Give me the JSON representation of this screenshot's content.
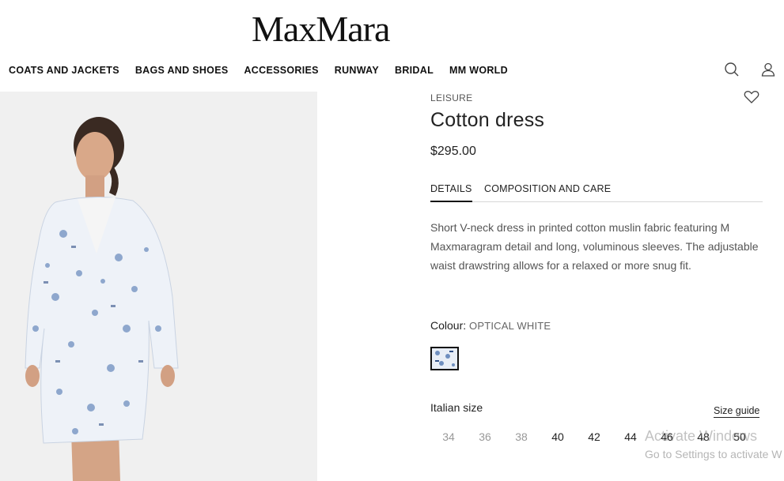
{
  "brand": {
    "logo_text": "MaxMara"
  },
  "nav": {
    "items": [
      {
        "label": "COATS AND JACKETS"
      },
      {
        "label": "BAGS AND SHOES"
      },
      {
        "label": "ACCESSORIES"
      },
      {
        "label": "RUNWAY"
      },
      {
        "label": "BRIDAL"
      },
      {
        "label": "MM WORLD"
      }
    ],
    "icons": {
      "search": "search-icon",
      "account": "user-icon"
    }
  },
  "product": {
    "category": "LEISURE",
    "title": "Cotton dress",
    "price": "$295.00",
    "tabs": [
      {
        "label": "DETAILS",
        "active": true
      },
      {
        "label": "COMPOSITION AND CARE",
        "active": false
      }
    ],
    "description": "Short V-neck dress in printed cotton muslin fabric featuring M Maxmaragram detail and long, voluminous sleeves. The adjustable waist drawstring allows for a relaxed or more snug fit.",
    "colour_label": "Colour:",
    "colour_value": "OPTICAL WHITE",
    "size_label": "Italian size",
    "size_guide": "Size guide",
    "sizes": [
      {
        "label": "34",
        "available": false
      },
      {
        "label": "36",
        "available": false
      },
      {
        "label": "38",
        "available": false
      },
      {
        "label": "40",
        "available": true
      },
      {
        "label": "42",
        "available": true
      },
      {
        "label": "44",
        "available": true
      },
      {
        "label": "46",
        "available": true
      },
      {
        "label": "48",
        "available": true
      },
      {
        "label": "50",
        "available": true
      }
    ]
  },
  "watermark": {
    "line1": "Activate Windows",
    "line2": "Go to Settings to activate W"
  },
  "colors": {
    "accent": "#111111",
    "muted": "#555555",
    "swatch": "#e8eef6"
  }
}
